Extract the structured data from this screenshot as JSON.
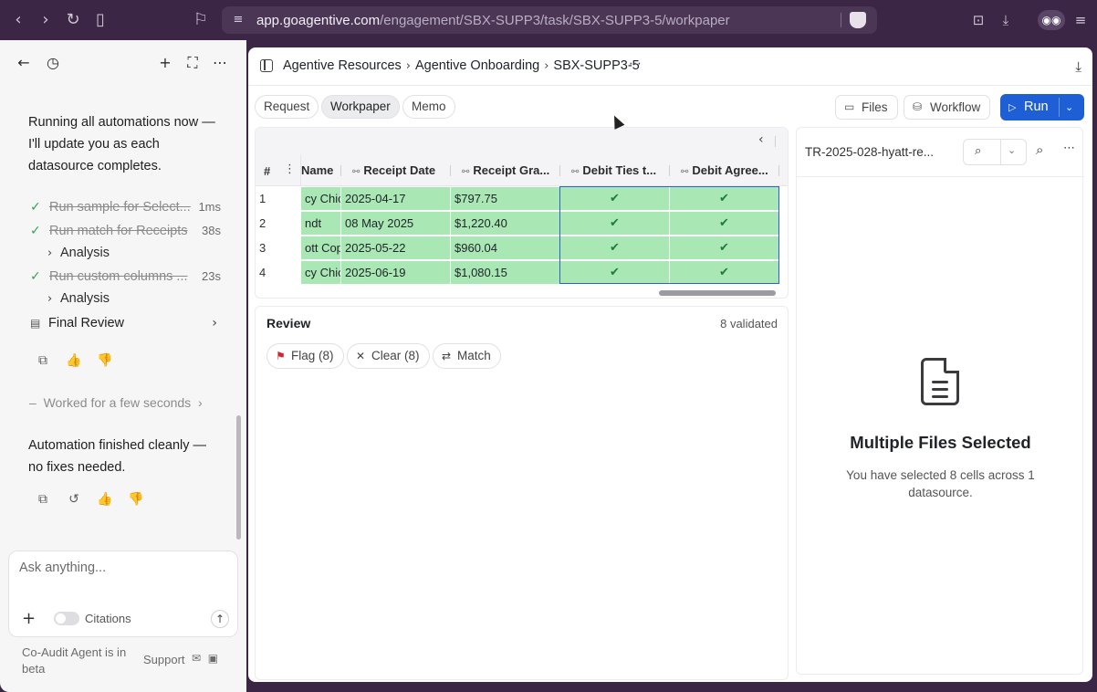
{
  "browser": {
    "url_host": "app.goagentive.com",
    "url_path": "/engagement/SBX-SUPP3/task/SBX-SUPP3-5/workpaper",
    "icons": [
      "back-icon",
      "forward-icon",
      "reload-icon",
      "sidebar-icon",
      "bookmark-icon",
      "site-settings-icon",
      "brave-shield-icon",
      "screenshot-icon",
      "download-icon",
      "profile-icon",
      "menu-icon"
    ]
  },
  "chat": {
    "msg1": "Running all automations now — I'll update you as each datasource completes.",
    "tasks": [
      {
        "name": "Run sample for Select...",
        "time": "1ms"
      },
      {
        "name": "Run match for Receipts",
        "time": "38s"
      },
      {
        "name": "Run custom columns ...",
        "time": "23s"
      }
    ],
    "analysis_label": "Analysis",
    "final_review": "Final Review",
    "worked": "Worked for a few seconds",
    "msg2": "Automation finished cleanly — no fixes needed.",
    "input_placeholder": "Ask anything...",
    "citations": "Citations",
    "beta_note": "Co-Audit Agent is in beta",
    "support": "Support"
  },
  "header": {
    "crumbs": [
      "Agentive Resources",
      "Agentive Onboarding",
      "SBX-SUPP3-5"
    ]
  },
  "tabs": [
    "Request",
    "Workpaper",
    "Memo"
  ],
  "active_tab": "Workpaper",
  "toolbar": {
    "files": "Files",
    "workflow": "Workflow",
    "run": "Run",
    "run_color": "#1f5fd6"
  },
  "table": {
    "hash": "#",
    "columns": [
      "Name",
      "Receipt Date",
      "Receipt Gra...",
      "Debit Ties t...",
      "Debit Agree..."
    ],
    "rows": [
      {
        "n": "1",
        "name": "cy Chica",
        "date": "2025-04-17",
        "amount": "$797.75",
        "c1": "✔",
        "c2": "✔"
      },
      {
        "n": "2",
        "name": "ndt",
        "date": "08 May 2025",
        "amount": "$1,220.40",
        "c1": "✔",
        "c2": "✔"
      },
      {
        "n": "3",
        "name": "ott Cop",
        "date": "2025-05-22",
        "amount": "$960.04",
        "c1": "✔",
        "c2": "✔"
      },
      {
        "n": "4",
        "name": "cy Chica",
        "date": "2025-06-19",
        "amount": "$1,080.15",
        "c1": "✔",
        "c2": "✔"
      }
    ],
    "highlight_color": "#a9e7b5"
  },
  "review": {
    "title": "Review",
    "validated": "8 validated",
    "flag": "Flag (8)",
    "clear": "Clear (8)",
    "match": "Match"
  },
  "filepane": {
    "filename": "TR-2025-028-hyatt-re...",
    "title": "Multiple Files Selected",
    "subtitle": "You have selected 8 cells across 1 datasource."
  }
}
